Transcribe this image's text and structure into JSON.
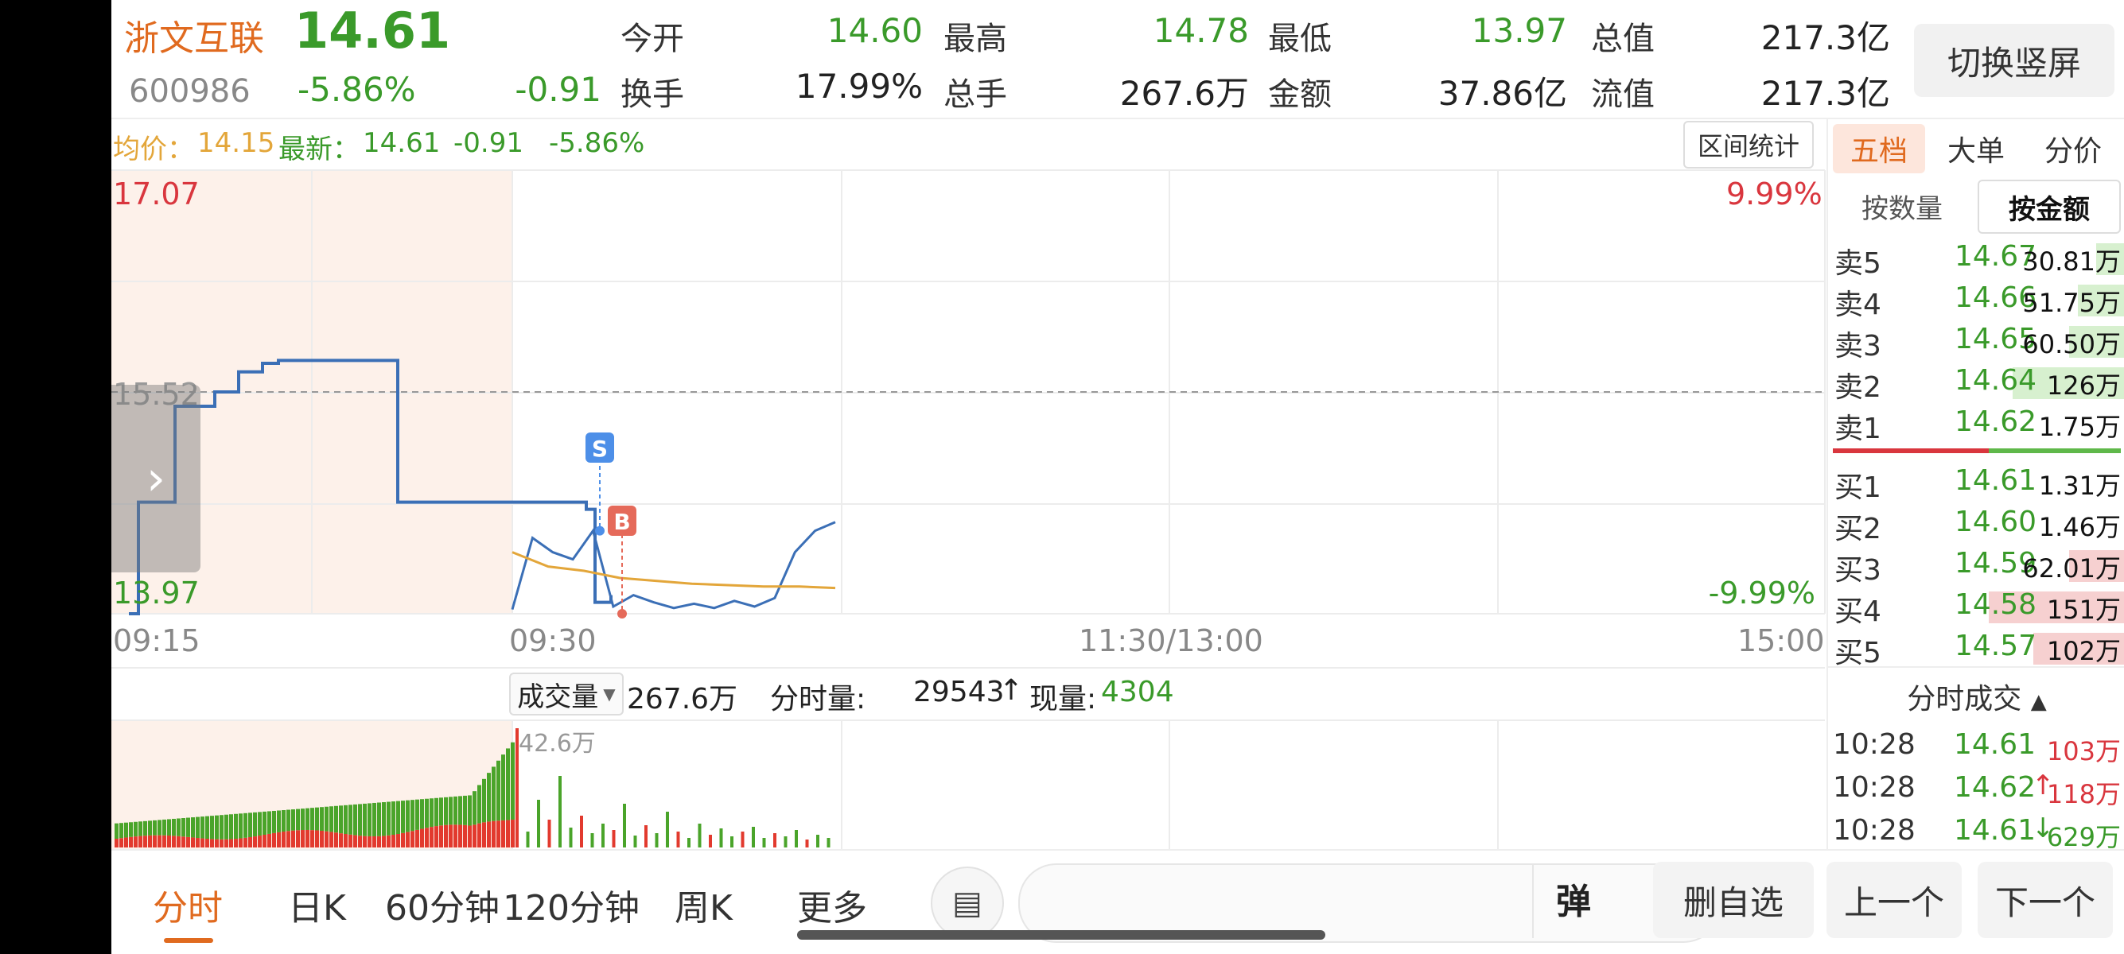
{
  "stock": {
    "name": "浙文互联",
    "price": "14.61",
    "code": "600986",
    "change_pct": "-5.86%",
    "change": "-0.91"
  },
  "stats": [
    {
      "label": "今开",
      "value": "14.60",
      "color": "green"
    },
    {
      "label": "最高",
      "value": "14.78",
      "color": "green"
    },
    {
      "label": "最低",
      "value": "13.97",
      "color": "green"
    },
    {
      "label": "总值",
      "value": "217.3亿",
      "color": "dark"
    },
    {
      "label": "换手",
      "value": "17.99%",
      "color": "dark"
    },
    {
      "label": "总手",
      "value": "267.6万",
      "color": "dark"
    },
    {
      "label": "金额",
      "value": "37.86亿",
      "color": "dark"
    },
    {
      "label": "流值",
      "value": "217.3亿",
      "color": "dark"
    }
  ],
  "switch_label": "切换竖屏",
  "info": {
    "avg_label": "均价：",
    "avg_value": "14.15",
    "latest_label": "最新：",
    "latest_value": "14.61",
    "latest_change": "-0.91",
    "latest_pct": "-5.86%",
    "range_button": "区间统计"
  },
  "chart_data": {
    "type": "line",
    "y_max_label": "17.07",
    "y_min_label": "13.97",
    "ref_label": "15.52",
    "pct_top": "9.99%",
    "pct_bottom": "-9.99%",
    "ylim": [
      13.97,
      17.07
    ],
    "x_ticks": [
      "09:15",
      "09:30",
      "11:30/13:00",
      "15:00"
    ],
    "markers": [
      {
        "label": "S",
        "color": "#4d8fe8"
      },
      {
        "label": "B",
        "color": "#e56a5a"
      }
    ],
    "series": [
      {
        "color": "#3b6fb6",
        "values": [
          13.97,
          14.75,
          15.42,
          15.52,
          15.66,
          15.72,
          15.74,
          15.74,
          14.75,
          14.75,
          14.75,
          14.7,
          14.05,
          14.1,
          14.0,
          14.5,
          14.4,
          14.35,
          14.55,
          14.02,
          14.1,
          14.05,
          14.01,
          14.04,
          14.01,
          14.06,
          14.02,
          14.08,
          14.4,
          14.55,
          14.61
        ]
      },
      {
        "color": "#e3a63a",
        "values": [
          14.4,
          14.3,
          14.27,
          14.22,
          14.2,
          14.18,
          14.17,
          14.16,
          14.16,
          14.15
        ]
      }
    ],
    "volume": {
      "max_label": "42.6万"
    }
  },
  "tabs": [
    "五档",
    "大单",
    "分价"
  ],
  "subtabs": [
    "按数量",
    "按金额"
  ],
  "orderbook": {
    "sells": [
      {
        "label": "卖5",
        "price": "14.67",
        "vol": "30.81万",
        "bar": 0.1
      },
      {
        "label": "卖4",
        "price": "14.66",
        "vol": "51.75万",
        "bar": 0.16
      },
      {
        "label": "卖3",
        "price": "14.65",
        "vol": "60.50万",
        "bar": 0.19
      },
      {
        "label": "卖2",
        "price": "14.64",
        "vol": "126万",
        "bar": 0.38
      },
      {
        "label": "卖1",
        "price": "14.62",
        "vol": "1.75万",
        "bar": 0.0
      }
    ],
    "buys": [
      {
        "label": "买1",
        "price": "14.61",
        "vol": "1.31万",
        "bar": 0.0
      },
      {
        "label": "买2",
        "price": "14.60",
        "vol": "1.46万",
        "bar": 0.0
      },
      {
        "label": "买3",
        "price": "14.59",
        "vol": "62.01万",
        "bar": 0.19
      },
      {
        "label": "买4",
        "price": "14.58",
        "vol": "151万",
        "bar": 0.46
      },
      {
        "label": "买5",
        "price": "14.57",
        "vol": "102万",
        "bar": 0.31
      }
    ]
  },
  "trades": {
    "title": "分时成交",
    "rows": [
      {
        "time": "10:28",
        "price": "14.61",
        "arrow": "",
        "vol": "103万",
        "vol_color": "red"
      },
      {
        "time": "10:28",
        "price": "14.62",
        "arrow": "↑",
        "vol": "118万",
        "vol_color": "red"
      },
      {
        "time": "10:28",
        "price": "14.61",
        "arrow": "↓",
        "vol": "629万",
        "vol_color": "green"
      }
    ]
  },
  "volume_head": {
    "select_label": "成交量",
    "total": "267.6万",
    "fenshi_label": "分时量:",
    "fenshi_value": "29543",
    "fenshi_arrow": "↑",
    "now_label": "现量:",
    "now_value": "4304"
  },
  "bottom_tabs": [
    "分时",
    "日K",
    "60分钟",
    "120分钟",
    "周K",
    "更多"
  ],
  "bottom": {
    "danmu": "弹",
    "remove": "删自选",
    "prev": "上一个",
    "next": "下一个"
  }
}
